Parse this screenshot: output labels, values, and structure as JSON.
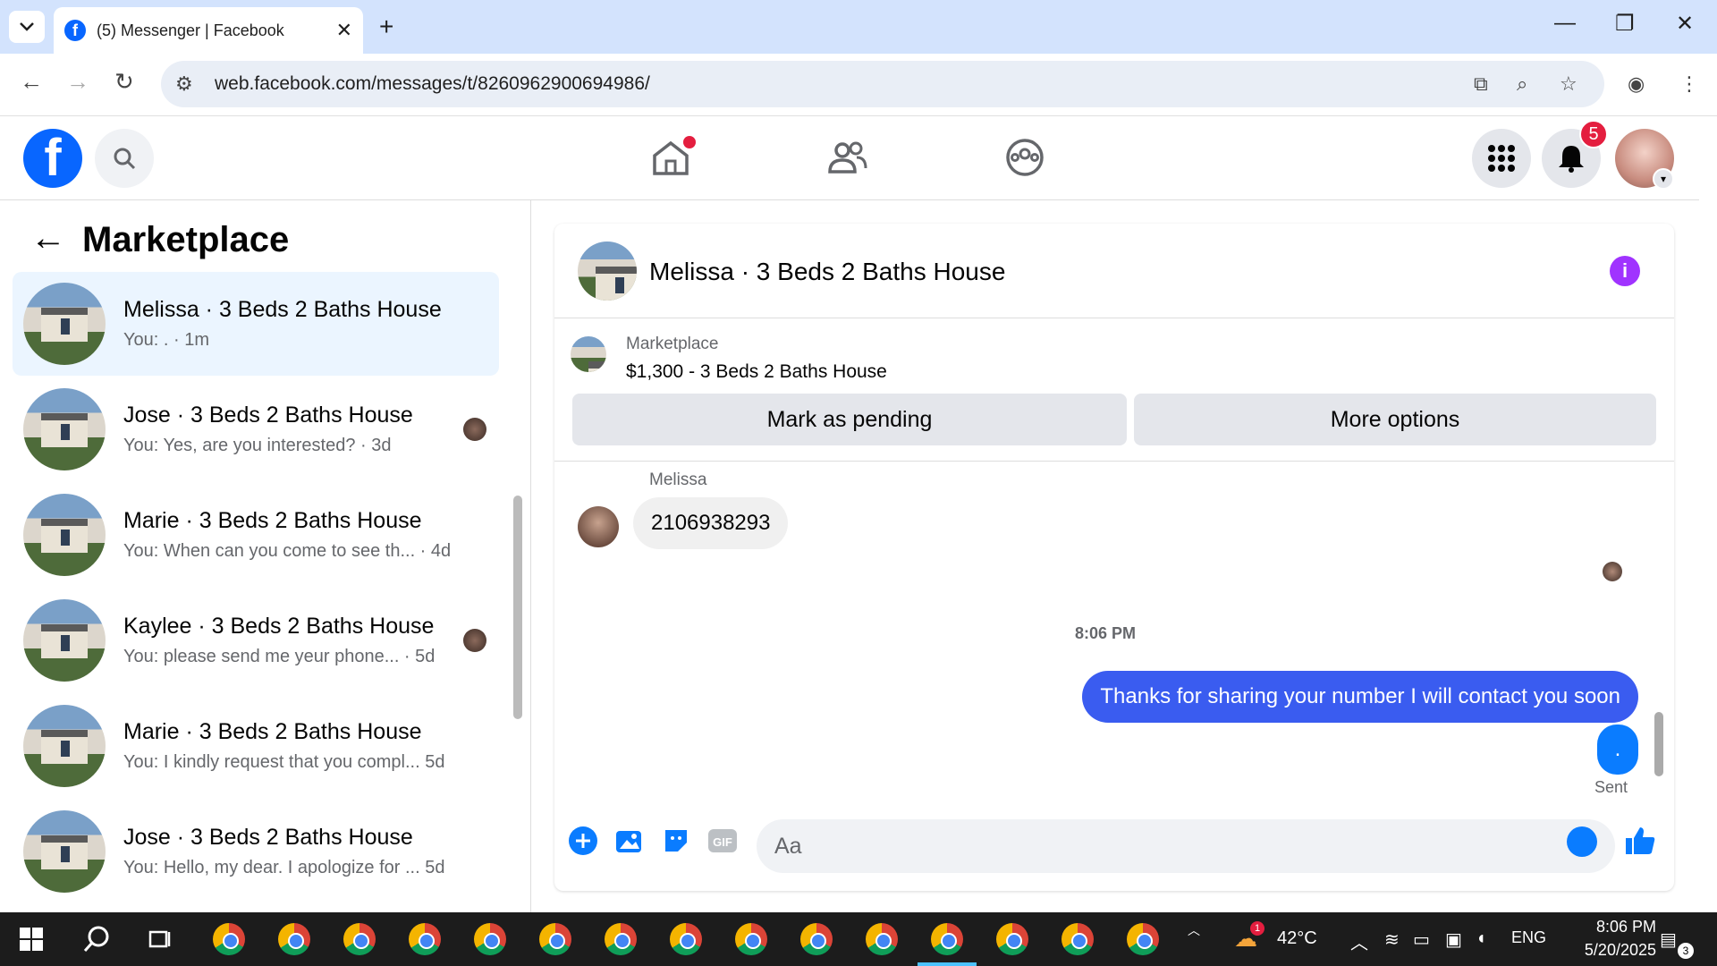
{
  "browser": {
    "tab_title": "(5) Messenger | Facebook",
    "url": "web.facebook.com/messages/t/8260962900694986/"
  },
  "header": {
    "notification_count": "5"
  },
  "sidebar": {
    "title": "Marketplace",
    "conversations": [
      {
        "name": "Melissa · 3 Beds 2 Baths House",
        "preview": "You: . · 1m"
      },
      {
        "name": "Jose · 3 Beds 2 Baths House",
        "preview": "You: Yes, are you interested? · 3d"
      },
      {
        "name": "Marie · 3 Beds 2 Baths House",
        "preview": "You: When can you come to see th... · 4d"
      },
      {
        "name": "Kaylee · 3 Beds 2 Baths House",
        "preview": "You: please send me yeur phone... · 5d"
      },
      {
        "name": "Marie · 3 Beds 2 Baths House",
        "preview": "You: I kindly request that you compl... 5d"
      },
      {
        "name": "Jose · 3 Beds 2 Baths House",
        "preview": "You: Hello, my dear. I apologize for ... 5d"
      }
    ]
  },
  "chat": {
    "title": "Melissa · 3 Beds 2 Baths House",
    "listing_label": "Marketplace",
    "listing_price": "$1,300 - 3 Beds 2 Baths House",
    "mark_pending": "Mark as pending",
    "more_options": "More options",
    "sender_name": "Melissa",
    "incoming_message": "2106938293",
    "timestamp": "8:06 PM",
    "outgoing_message": "Thanks for sharing your number I will contact you soon",
    "outgoing_dot": ".",
    "status": "Sent",
    "composer_placeholder": "Aa"
  },
  "taskbar": {
    "temperature": "42°C",
    "language": "ENG",
    "time": "8:06 PM",
    "date": "5/20/2025",
    "notification_count": "3",
    "weather_badge": "1"
  }
}
